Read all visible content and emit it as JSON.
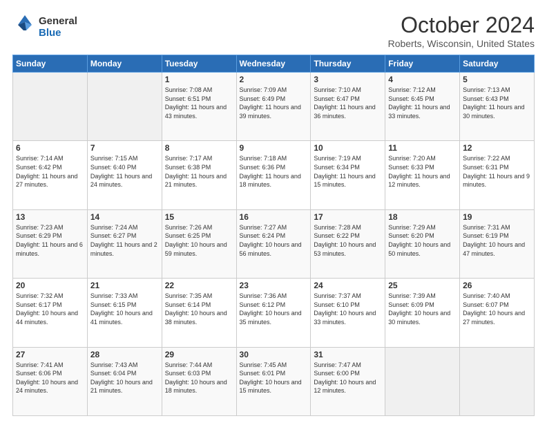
{
  "header": {
    "logo_general": "General",
    "logo_blue": "Blue",
    "month_title": "October 2024",
    "location": "Roberts, Wisconsin, United States"
  },
  "days_of_week": [
    "Sunday",
    "Monday",
    "Tuesday",
    "Wednesday",
    "Thursday",
    "Friday",
    "Saturday"
  ],
  "weeks": [
    [
      {
        "day": "",
        "sunrise": "",
        "sunset": "",
        "daylight": "",
        "empty": true
      },
      {
        "day": "",
        "sunrise": "",
        "sunset": "",
        "daylight": "",
        "empty": true
      },
      {
        "day": "1",
        "sunrise": "Sunrise: 7:08 AM",
        "sunset": "Sunset: 6:51 PM",
        "daylight": "Daylight: 11 hours and 43 minutes."
      },
      {
        "day": "2",
        "sunrise": "Sunrise: 7:09 AM",
        "sunset": "Sunset: 6:49 PM",
        "daylight": "Daylight: 11 hours and 39 minutes."
      },
      {
        "day": "3",
        "sunrise": "Sunrise: 7:10 AM",
        "sunset": "Sunset: 6:47 PM",
        "daylight": "Daylight: 11 hours and 36 minutes."
      },
      {
        "day": "4",
        "sunrise": "Sunrise: 7:12 AM",
        "sunset": "Sunset: 6:45 PM",
        "daylight": "Daylight: 11 hours and 33 minutes."
      },
      {
        "day": "5",
        "sunrise": "Sunrise: 7:13 AM",
        "sunset": "Sunset: 6:43 PM",
        "daylight": "Daylight: 11 hours and 30 minutes."
      }
    ],
    [
      {
        "day": "6",
        "sunrise": "Sunrise: 7:14 AM",
        "sunset": "Sunset: 6:42 PM",
        "daylight": "Daylight: 11 hours and 27 minutes."
      },
      {
        "day": "7",
        "sunrise": "Sunrise: 7:15 AM",
        "sunset": "Sunset: 6:40 PM",
        "daylight": "Daylight: 11 hours and 24 minutes."
      },
      {
        "day": "8",
        "sunrise": "Sunrise: 7:17 AM",
        "sunset": "Sunset: 6:38 PM",
        "daylight": "Daylight: 11 hours and 21 minutes."
      },
      {
        "day": "9",
        "sunrise": "Sunrise: 7:18 AM",
        "sunset": "Sunset: 6:36 PM",
        "daylight": "Daylight: 11 hours and 18 minutes."
      },
      {
        "day": "10",
        "sunrise": "Sunrise: 7:19 AM",
        "sunset": "Sunset: 6:34 PM",
        "daylight": "Daylight: 11 hours and 15 minutes."
      },
      {
        "day": "11",
        "sunrise": "Sunrise: 7:20 AM",
        "sunset": "Sunset: 6:33 PM",
        "daylight": "Daylight: 11 hours and 12 minutes."
      },
      {
        "day": "12",
        "sunrise": "Sunrise: 7:22 AM",
        "sunset": "Sunset: 6:31 PM",
        "daylight": "Daylight: 11 hours and 9 minutes."
      }
    ],
    [
      {
        "day": "13",
        "sunrise": "Sunrise: 7:23 AM",
        "sunset": "Sunset: 6:29 PM",
        "daylight": "Daylight: 11 hours and 6 minutes."
      },
      {
        "day": "14",
        "sunrise": "Sunrise: 7:24 AM",
        "sunset": "Sunset: 6:27 PM",
        "daylight": "Daylight: 11 hours and 2 minutes."
      },
      {
        "day": "15",
        "sunrise": "Sunrise: 7:26 AM",
        "sunset": "Sunset: 6:25 PM",
        "daylight": "Daylight: 10 hours and 59 minutes."
      },
      {
        "day": "16",
        "sunrise": "Sunrise: 7:27 AM",
        "sunset": "Sunset: 6:24 PM",
        "daylight": "Daylight: 10 hours and 56 minutes."
      },
      {
        "day": "17",
        "sunrise": "Sunrise: 7:28 AM",
        "sunset": "Sunset: 6:22 PM",
        "daylight": "Daylight: 10 hours and 53 minutes."
      },
      {
        "day": "18",
        "sunrise": "Sunrise: 7:29 AM",
        "sunset": "Sunset: 6:20 PM",
        "daylight": "Daylight: 10 hours and 50 minutes."
      },
      {
        "day": "19",
        "sunrise": "Sunrise: 7:31 AM",
        "sunset": "Sunset: 6:19 PM",
        "daylight": "Daylight: 10 hours and 47 minutes."
      }
    ],
    [
      {
        "day": "20",
        "sunrise": "Sunrise: 7:32 AM",
        "sunset": "Sunset: 6:17 PM",
        "daylight": "Daylight: 10 hours and 44 minutes."
      },
      {
        "day": "21",
        "sunrise": "Sunrise: 7:33 AM",
        "sunset": "Sunset: 6:15 PM",
        "daylight": "Daylight: 10 hours and 41 minutes."
      },
      {
        "day": "22",
        "sunrise": "Sunrise: 7:35 AM",
        "sunset": "Sunset: 6:14 PM",
        "daylight": "Daylight: 10 hours and 38 minutes."
      },
      {
        "day": "23",
        "sunrise": "Sunrise: 7:36 AM",
        "sunset": "Sunset: 6:12 PM",
        "daylight": "Daylight: 10 hours and 35 minutes."
      },
      {
        "day": "24",
        "sunrise": "Sunrise: 7:37 AM",
        "sunset": "Sunset: 6:10 PM",
        "daylight": "Daylight: 10 hours and 33 minutes."
      },
      {
        "day": "25",
        "sunrise": "Sunrise: 7:39 AM",
        "sunset": "Sunset: 6:09 PM",
        "daylight": "Daylight: 10 hours and 30 minutes."
      },
      {
        "day": "26",
        "sunrise": "Sunrise: 7:40 AM",
        "sunset": "Sunset: 6:07 PM",
        "daylight": "Daylight: 10 hours and 27 minutes."
      }
    ],
    [
      {
        "day": "27",
        "sunrise": "Sunrise: 7:41 AM",
        "sunset": "Sunset: 6:06 PM",
        "daylight": "Daylight: 10 hours and 24 minutes."
      },
      {
        "day": "28",
        "sunrise": "Sunrise: 7:43 AM",
        "sunset": "Sunset: 6:04 PM",
        "daylight": "Daylight: 10 hours and 21 minutes."
      },
      {
        "day": "29",
        "sunrise": "Sunrise: 7:44 AM",
        "sunset": "Sunset: 6:03 PM",
        "daylight": "Daylight: 10 hours and 18 minutes."
      },
      {
        "day": "30",
        "sunrise": "Sunrise: 7:45 AM",
        "sunset": "Sunset: 6:01 PM",
        "daylight": "Daylight: 10 hours and 15 minutes."
      },
      {
        "day": "31",
        "sunrise": "Sunrise: 7:47 AM",
        "sunset": "Sunset: 6:00 PM",
        "daylight": "Daylight: 10 hours and 12 minutes."
      },
      {
        "day": "",
        "sunrise": "",
        "sunset": "",
        "daylight": "",
        "empty": true
      },
      {
        "day": "",
        "sunrise": "",
        "sunset": "",
        "daylight": "",
        "empty": true
      }
    ]
  ]
}
